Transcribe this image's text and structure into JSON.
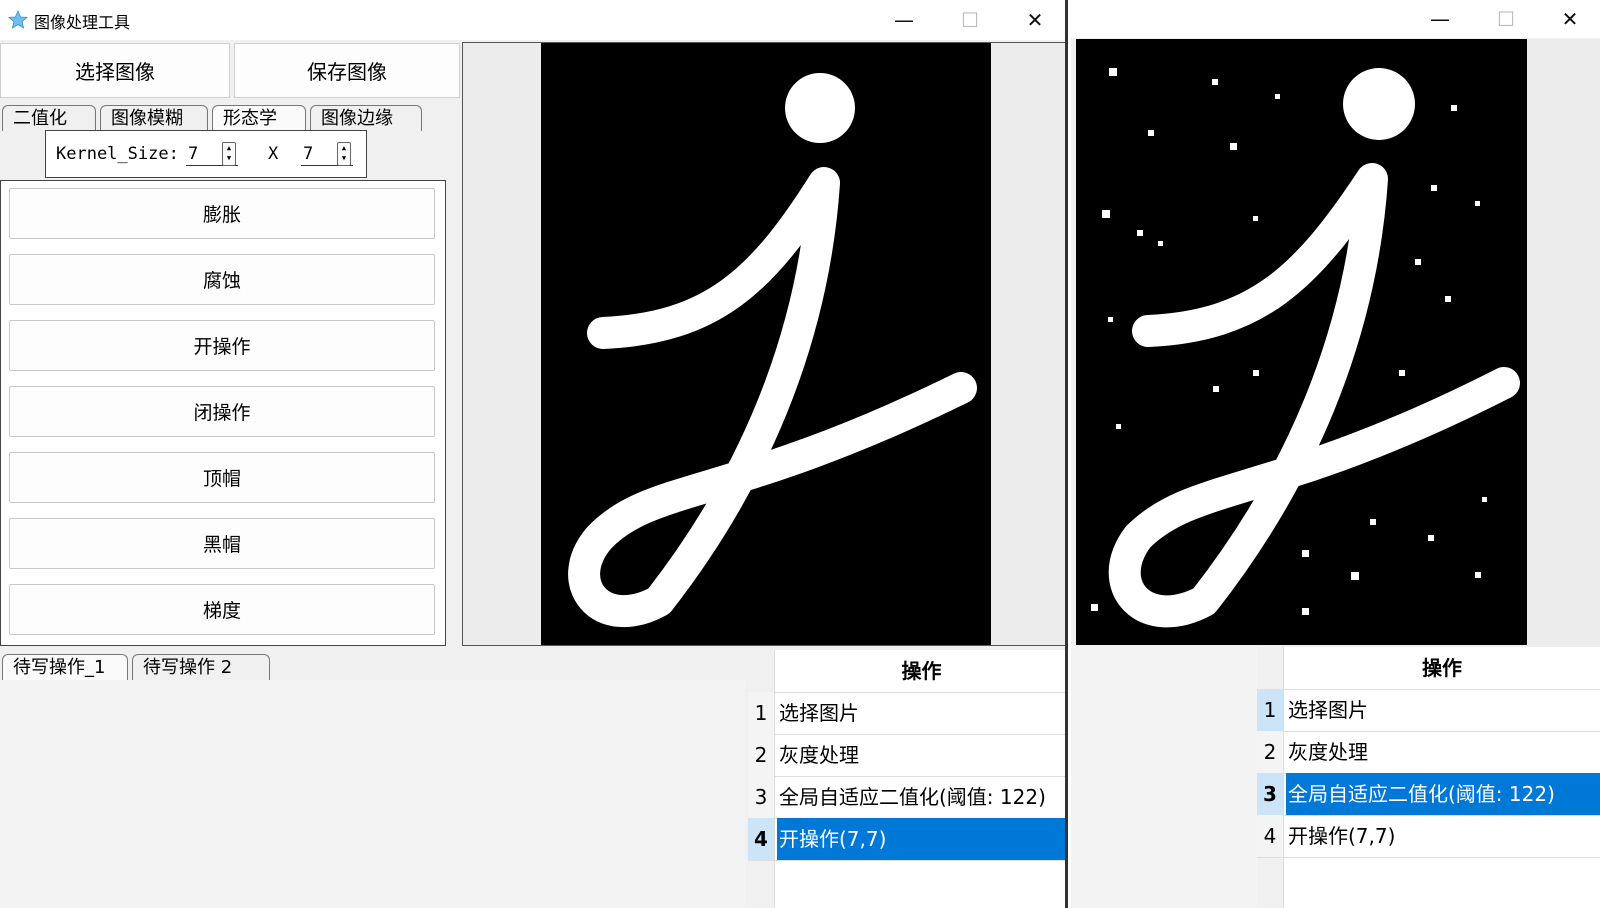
{
  "left_window": {
    "title": "图像处理工具",
    "controls": {
      "minimize": "—",
      "maximize": "☐",
      "close": "✕"
    },
    "toolbar": {
      "select_image": "选择图像",
      "save_image": "保存图像"
    },
    "tabs": [
      "二值化",
      "图像模糊",
      "形态学",
      "图像边缘"
    ],
    "kernel": {
      "label": "Kernel_Size:",
      "width": "7",
      "separator": "X",
      "height": "7"
    },
    "operations": [
      "膨胀",
      "腐蚀",
      "开操作",
      "闭操作",
      "顶帽",
      "黑帽",
      "梯度"
    ],
    "bottom_tabs": [
      "待写操作_1",
      "待写操作 2"
    ],
    "history": {
      "header": "操作",
      "rows": [
        {
          "index": "1",
          "text": "选择图片"
        },
        {
          "index": "2",
          "text": "灰度处理"
        },
        {
          "index": "3",
          "text": "全局自适应二值化(阈值: 122)"
        },
        {
          "index": "4",
          "text": "开操作(7,7)"
        }
      ],
      "selected_index": "4"
    }
  },
  "right_window": {
    "controls": {
      "minimize": "—",
      "maximize": "☐",
      "close": "✕"
    },
    "history": {
      "header": "操作",
      "rows": [
        {
          "index": "1",
          "text": "选择图片"
        },
        {
          "index": "2",
          "text": "灰度处理"
        },
        {
          "index": "3",
          "text": "全局自适应二值化(阈值: 122)"
        },
        {
          "index": "4",
          "text": "开操作(7,7)"
        }
      ],
      "selected_index": "3"
    }
  },
  "colors": {
    "selection": "#0078d7",
    "selection_text": "#ffffff",
    "image_bg": "#000000",
    "image_fg": "#ffffff"
  },
  "icons": {
    "app": "star-app-icon"
  }
}
